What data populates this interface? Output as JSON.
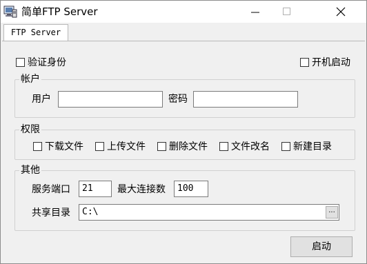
{
  "window": {
    "title": "简单FTP Server"
  },
  "tabs": [
    {
      "label": "FTP Server",
      "selected": true
    }
  ],
  "options": {
    "auth_label": "验证身份",
    "auth_checked": false,
    "autostart_label": "开机启动",
    "autostart_checked": false
  },
  "account": {
    "group_title": "帐户",
    "user_label": "用户",
    "user_value": "",
    "password_label": "密码",
    "password_value": ""
  },
  "permissions": {
    "group_title": "权限",
    "items": [
      {
        "label": "下载文件",
        "checked": false
      },
      {
        "label": "上传文件",
        "checked": false
      },
      {
        "label": "删除文件",
        "checked": false
      },
      {
        "label": "文件改名",
        "checked": false
      },
      {
        "label": "新建目录",
        "checked": false
      }
    ]
  },
  "other": {
    "group_title": "其他",
    "port_label": "服务端口",
    "port_value": "21",
    "max_conn_label": "最大连接数",
    "max_conn_value": "100",
    "share_dir_label": "共享目录",
    "share_dir_value": "C:\\",
    "browse_label": "..."
  },
  "actions": {
    "start_label": "启动"
  },
  "icons": {
    "app": "app-icon",
    "minimize": "minimize-icon",
    "maximize": "maximize-icon",
    "close": "close-icon"
  }
}
